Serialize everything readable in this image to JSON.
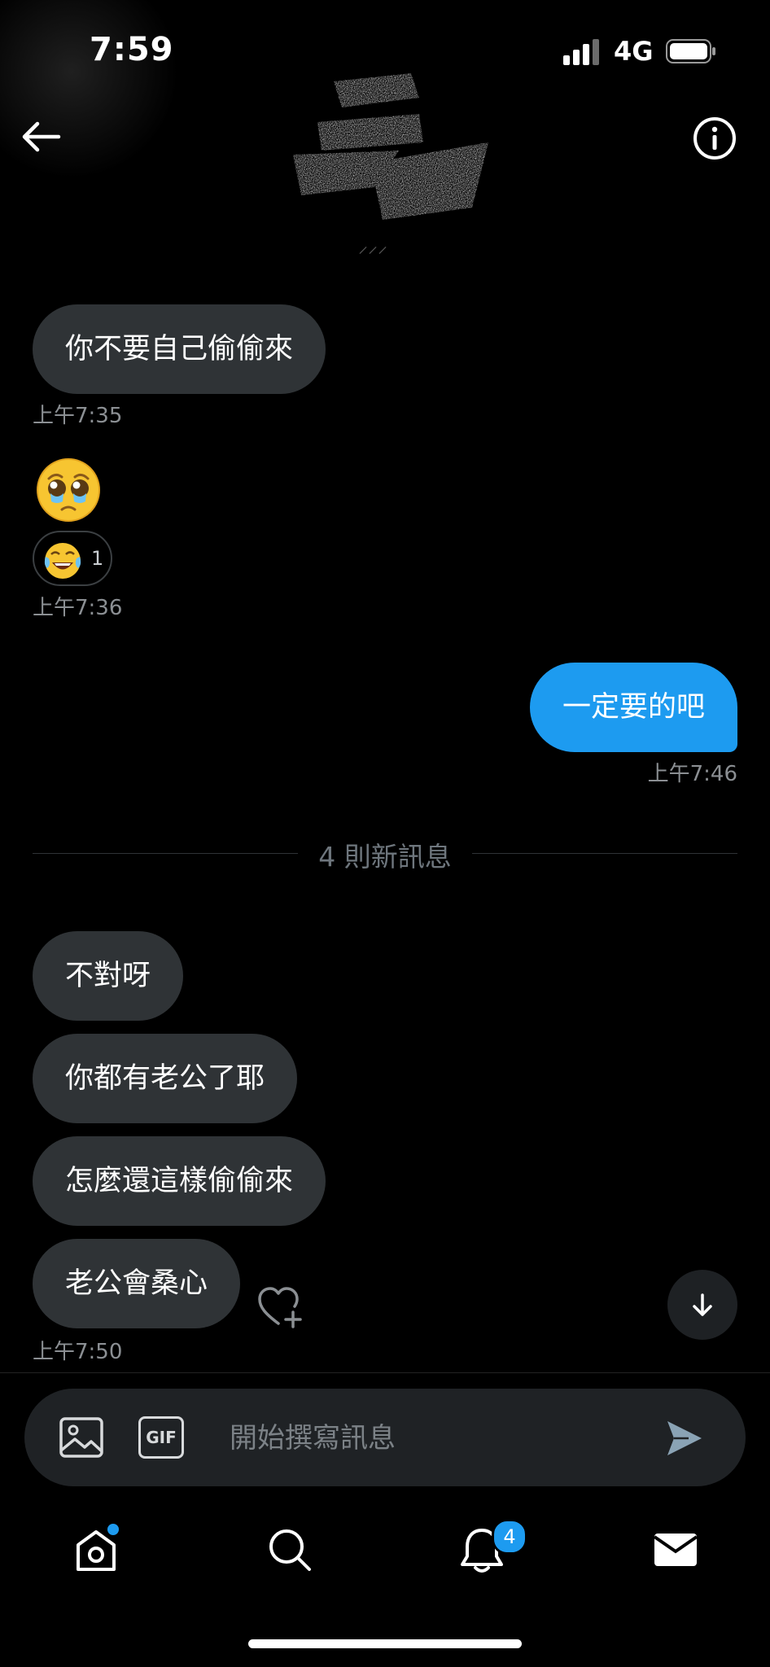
{
  "status_bar": {
    "time": "7:59",
    "network": "4G"
  },
  "messages": [
    {
      "text": "你不要自己偷偷來",
      "direction": "incoming"
    },
    {
      "emoji": "pleading-face-with-tears",
      "direction": "incoming",
      "reaction": {
        "emoji": "tears-of-joy",
        "count": "1"
      }
    },
    {
      "text": "一定要的吧",
      "direction": "outgoing"
    },
    {
      "text": "不對呀",
      "direction": "incoming"
    },
    {
      "text": "你都有老公了耶",
      "direction": "incoming"
    },
    {
      "text": "怎麼還這樣偷偷來",
      "direction": "incoming"
    },
    {
      "text": "老公會桑心",
      "direction": "incoming"
    }
  ],
  "timestamps": [
    "上午7:35",
    "上午7:36",
    "上午7:46",
    "上午7:50"
  ],
  "new_messages_divider": "4 則新訊息",
  "composer": {
    "gif_label": "GIF",
    "placeholder": "開始撰寫訊息"
  },
  "nav": {
    "notifications_badge": "4"
  },
  "colors": {
    "accent": "#1d9bf0",
    "incoming_bubble": "#2f3336",
    "background": "#000000"
  }
}
